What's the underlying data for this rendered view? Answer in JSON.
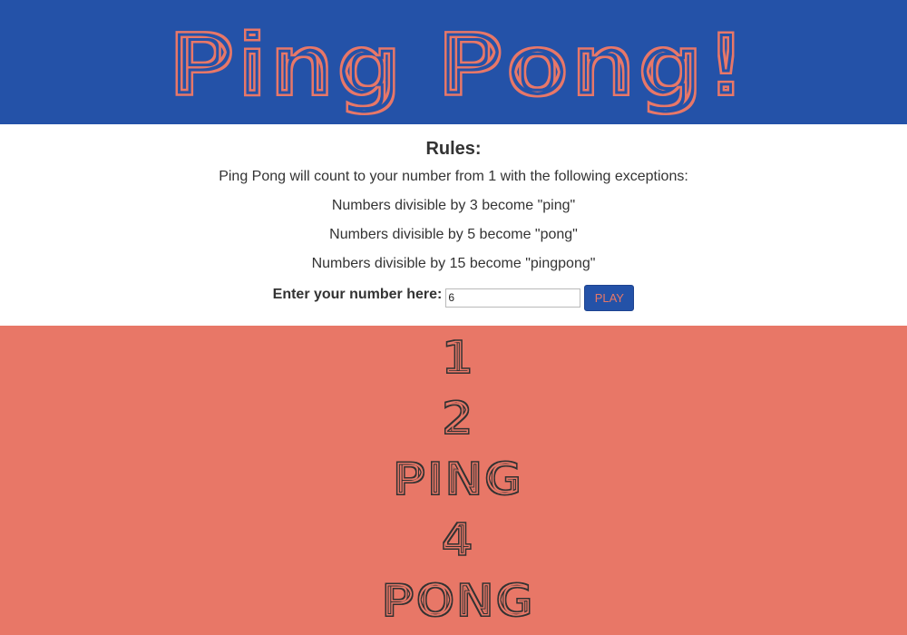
{
  "header": {
    "title": "Ping Pong!"
  },
  "rules": {
    "heading": "Rules:",
    "intro": "Ping Pong will count to your number from 1 with the following exceptions:",
    "items": [
      "Numbers divisible by 3 become \"ping\"",
      "Numbers divisible by 5 become \"pong\"",
      "Numbers divisible by 15 become \"pingpong\""
    ]
  },
  "form": {
    "label": "Enter your number here:",
    "value": "6",
    "button_label": "PLAY"
  },
  "results": [
    "1",
    "2",
    "PING",
    "4",
    "PONG"
  ],
  "colors": {
    "banner_bg": "#2452a8",
    "accent": "#e87767",
    "results_bg": "#e87767",
    "results_text": "#333333",
    "body_text": "#333333"
  }
}
